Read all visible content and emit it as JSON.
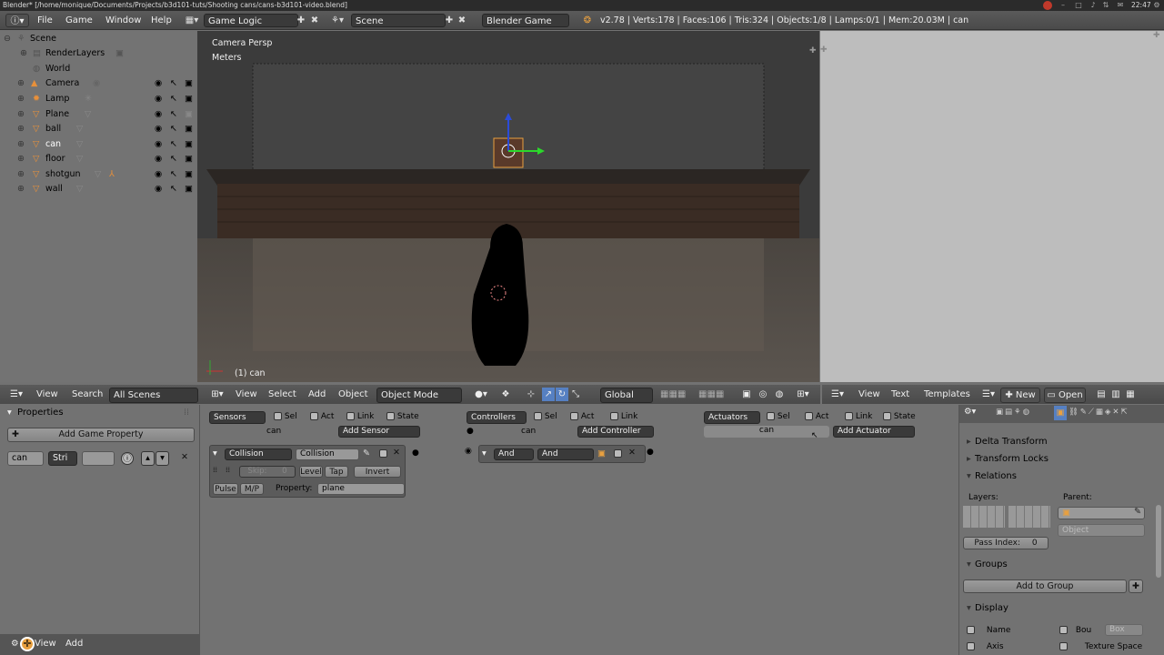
{
  "title_bar": {
    "title": "Blender* [/home/monique/Documents/Projects/b3d101-tuts/Shooting cans/cans-b3d101-video.blend]",
    "clock": "22:47"
  },
  "header": {
    "menu": [
      "File",
      "Game",
      "Window",
      "Help"
    ],
    "screen_name": "Game Logic",
    "scene_name": "Scene",
    "engine": "Blender Game",
    "stats": "v2.78 | Verts:178 | Faces:106 | Tris:324 | Objects:1/8 | Lamps:0/1 | Mem:20.03M | can"
  },
  "outliner": {
    "items": [
      {
        "label": "Scene",
        "icon": "scene-icon"
      },
      {
        "label": "RenderLayers",
        "icon": "renderlayers-icon"
      },
      {
        "label": "World",
        "icon": "world-icon"
      },
      {
        "label": "Camera",
        "icon": "camera-icon"
      },
      {
        "label": "Lamp",
        "icon": "lamp-icon"
      },
      {
        "label": "Plane",
        "icon": "mesh-icon"
      },
      {
        "label": "ball",
        "icon": "mesh-icon"
      },
      {
        "label": "can",
        "icon": "mesh-icon"
      },
      {
        "label": "floor",
        "icon": "mesh-icon"
      },
      {
        "label": "shotgun",
        "icon": "mesh-icon"
      },
      {
        "label": "wall",
        "icon": "mesh-icon"
      }
    ]
  },
  "viewport": {
    "view_name": "Camera Persp",
    "units": "Meters",
    "object_label": "(1) can"
  },
  "viewport_header": {
    "menus": [
      "View",
      "Select",
      "Add",
      "Object"
    ],
    "mode": "Object Mode",
    "orientation": "Global"
  },
  "text_header": {
    "menus": [
      "View",
      "Text",
      "Templates"
    ],
    "new_label": "New",
    "open_label": "Open"
  },
  "outliner_header": {
    "menus": [
      "View",
      "Search"
    ],
    "filter": "All Scenes"
  },
  "properties_panel": {
    "title": "Properties",
    "add_game_property": "Add Game Property",
    "prop_name": "can",
    "prop_type": "Stri",
    "footer_menus": [
      "View",
      "Add"
    ]
  },
  "logic": {
    "sensors_label": "Sensors",
    "controllers_label": "Controllers",
    "actuators_label": "Actuators",
    "toggles": [
      "Sel",
      "Act",
      "Link",
      "State"
    ],
    "controller_toggles": [
      "Sel",
      "Act",
      "Link"
    ],
    "object_name": "can",
    "add_sensor": "Add Sensor",
    "add_controller": "Add Controller",
    "add_actuator": "Add Actuator",
    "sensor": {
      "type": "Collision",
      "name": "Collision",
      "skip_label": "Skip:",
      "skip_value": "0",
      "level": "Level",
      "tap": "Tap",
      "invert": "Invert",
      "pulse": "Pulse",
      "mp": "M/P",
      "property_label": "Property:",
      "property_value": "plane"
    },
    "controller": {
      "type": "And",
      "name": "And"
    }
  },
  "object_props": {
    "delta_transform": "Delta Transform",
    "transform_locks": "Transform Locks",
    "relations": "Relations",
    "layers_label": "Layers:",
    "parent_label": "Parent:",
    "parent_type": "Object",
    "pass_index_label": "Pass Index:",
    "pass_index_value": "0",
    "groups": "Groups",
    "add_to_group": "Add to Group",
    "display": "Display",
    "name_label": "Name",
    "axis_label": "Axis",
    "bounds_label": "Bou",
    "bounds_type": "Box",
    "texture_space_label": "Texture Space"
  }
}
